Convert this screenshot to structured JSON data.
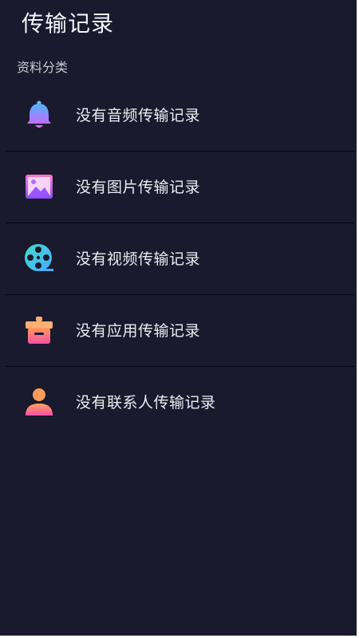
{
  "header": {
    "title": "传输记录"
  },
  "section": {
    "label": "资料分类"
  },
  "items": [
    {
      "label": "没有音频传输记录",
      "icon": "bell-icon"
    },
    {
      "label": "没有图片传输记录",
      "icon": "image-icon"
    },
    {
      "label": "没有视频传输记录",
      "icon": "film-reel-icon"
    },
    {
      "label": "没有应用传输记录",
      "icon": "app-box-icon"
    },
    {
      "label": "没有联系人传输记录",
      "icon": "person-icon"
    }
  ],
  "colors": {
    "background": "#191a2d",
    "divider": "#05060c",
    "text": "#ececf2",
    "muted_text": "#c7c8d3"
  }
}
